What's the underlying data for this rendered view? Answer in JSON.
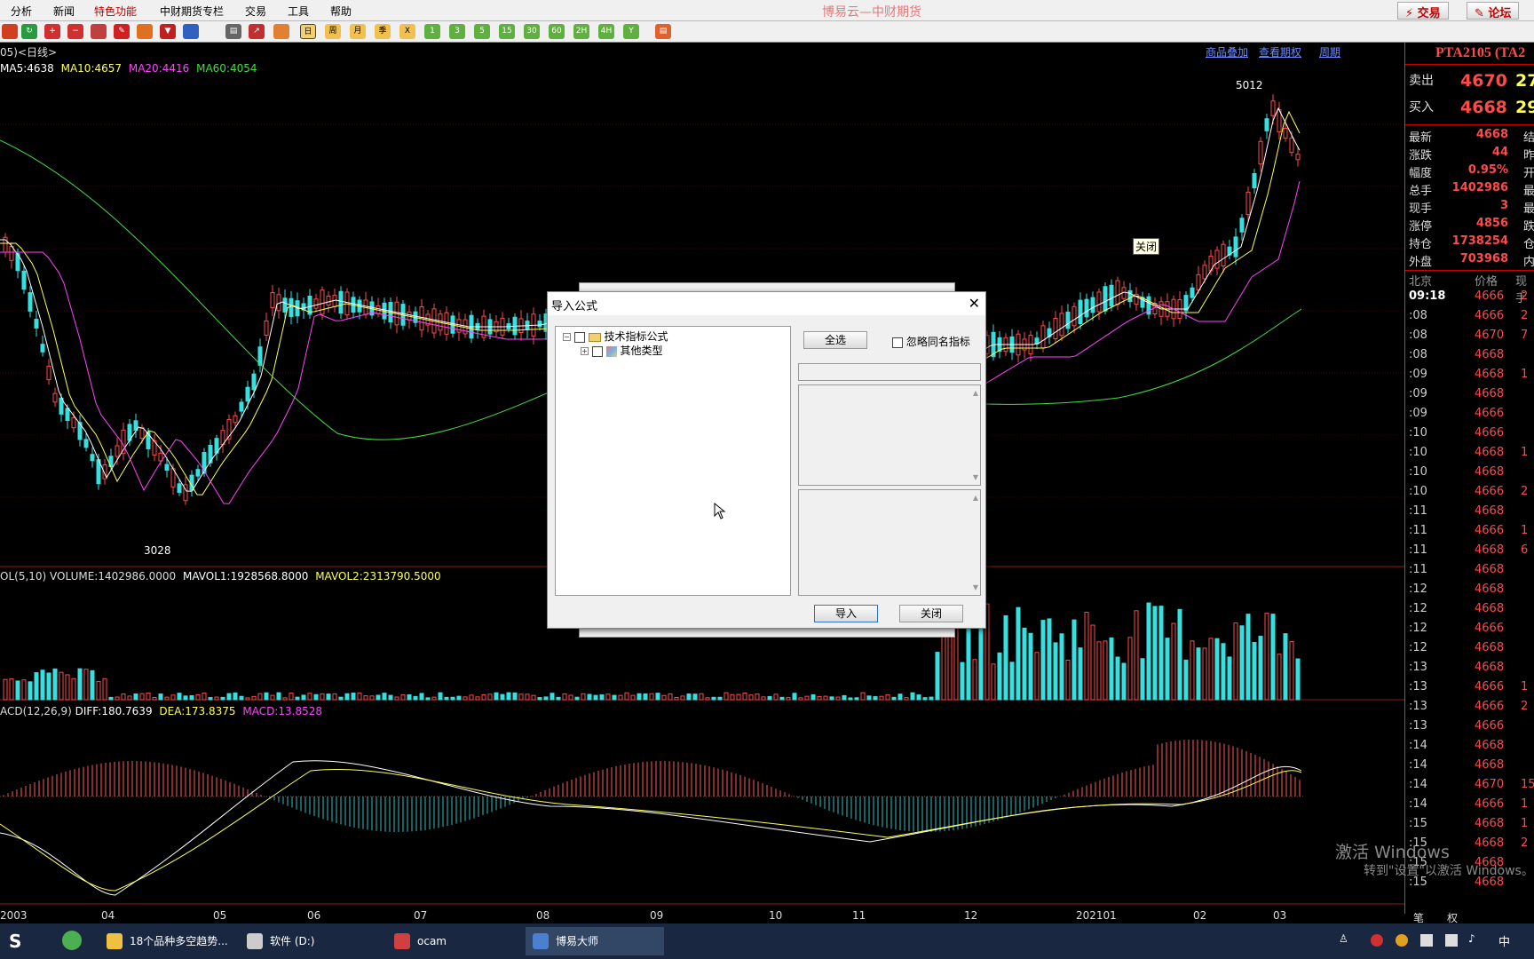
{
  "menu": [
    "分析",
    "新闻",
    "特色功能",
    "中财期货专栏",
    "交易",
    "工具",
    "帮助"
  ],
  "app_title": "博易云—中财期货",
  "top_buttons": {
    "trade": "交易",
    "forum": "论坛"
  },
  "toolbar_periods": [
    "日",
    "周",
    "月",
    "季",
    "X",
    "1",
    "3",
    "5",
    "15",
    "30",
    "60",
    "2H",
    "4H",
    "Y"
  ],
  "chart": {
    "period_label": "05)<日线>",
    "ma_labels": [
      "MA5:4638",
      "MA10:4657",
      "MA20:4416",
      "MA60:4054"
    ],
    "ma_colors": [
      "#ffffff",
      "#ffff55",
      "#ff44ff",
      "#44dd44"
    ],
    "high_label": "5012",
    "low_label": "3028",
    "close_tag": "关闭",
    "links": [
      "商品叠加",
      "查看期权",
      "周期"
    ],
    "vol_label_prefix": "OL(5,10)",
    "vol_labels": [
      "VOLUME:1402986.0000",
      "MAVOL1:1928568.8000",
      "MAVOL2:2313790.5000"
    ],
    "macd_label_prefix": "ACD(12,26,9)",
    "macd_labels": [
      "DIFF:180.7639",
      "DEA:173.8375",
      "MACD:13.8528"
    ],
    "x_labels": [
      "2003",
      "04",
      "05",
      "06",
      "07",
      "08",
      "09",
      "10",
      "11",
      "12",
      "202101",
      "02",
      "03"
    ]
  },
  "quote_panel": {
    "symbol": "PTA2105 (TA2",
    "ask": {
      "label": "卖出",
      "price": "4670",
      "vol": "27"
    },
    "bid": {
      "label": "买入",
      "price": "4668",
      "vol": "29"
    },
    "stats": [
      {
        "k": "最新",
        "v": "4668",
        "k2": "结"
      },
      {
        "k": "涨跌",
        "v": "44",
        "k2": "昨"
      },
      {
        "k": "幅度",
        "v": "0.95%",
        "k2": "开"
      },
      {
        "k": "总手",
        "v": "1402986",
        "k2": "最"
      },
      {
        "k": "现手",
        "v": "3",
        "k2": "最"
      },
      {
        "k": "涨停",
        "v": "4856",
        "k2": "跌"
      },
      {
        "k": "持仓",
        "v": "1738254",
        "k2": "仓"
      },
      {
        "k": "外盘",
        "v": "703968",
        "k2": "内"
      }
    ],
    "tick_header": [
      "北京",
      "价格",
      "现手"
    ],
    "ticks": [
      {
        "t": "09:18",
        "p": "4666",
        "q": "2"
      },
      {
        "t": ":08",
        "p": "4666",
        "q": "2"
      },
      {
        "t": ":08",
        "p": "4670",
        "q": "7"
      },
      {
        "t": ":08",
        "p": "4668",
        "q": ""
      },
      {
        "t": ":09",
        "p": "4668",
        "q": "1"
      },
      {
        "t": ":09",
        "p": "4668",
        "q": ""
      },
      {
        "t": ":09",
        "p": "4666",
        "q": ""
      },
      {
        "t": ":10",
        "p": "4666",
        "q": ""
      },
      {
        "t": ":10",
        "p": "4668",
        "q": "1"
      },
      {
        "t": ":10",
        "p": "4668",
        "q": ""
      },
      {
        "t": ":10",
        "p": "4666",
        "q": "2"
      },
      {
        "t": ":11",
        "p": "4668",
        "q": ""
      },
      {
        "t": ":11",
        "p": "4666",
        "q": "1"
      },
      {
        "t": ":11",
        "p": "4668",
        "q": "6"
      },
      {
        "t": ":11",
        "p": "4668",
        "q": ""
      },
      {
        "t": ":12",
        "p": "4668",
        "q": ""
      },
      {
        "t": ":12",
        "p": "4668",
        "q": ""
      },
      {
        "t": ":12",
        "p": "4666",
        "q": ""
      },
      {
        "t": ":12",
        "p": "4668",
        "q": ""
      },
      {
        "t": ":13",
        "p": "4668",
        "q": ""
      },
      {
        "t": ":13",
        "p": "4666",
        "q": "1"
      },
      {
        "t": ":13",
        "p": "4666",
        "q": "2"
      },
      {
        "t": ":13",
        "p": "4666",
        "q": ""
      },
      {
        "t": ":14",
        "p": "4668",
        "q": ""
      },
      {
        "t": ":14",
        "p": "4668",
        "q": ""
      },
      {
        "t": ":14",
        "p": "4670",
        "q": "15"
      },
      {
        "t": ":14",
        "p": "4666",
        "q": "1"
      },
      {
        "t": ":15",
        "p": "4668",
        "q": "1"
      },
      {
        "t": ":15",
        "p": "4668",
        "q": "2"
      },
      {
        "t": ":15",
        "p": "4668",
        "q": ""
      },
      {
        "t": ":15",
        "p": "4668",
        "q": ""
      }
    ],
    "bottom_tabs": [
      "笔",
      "权"
    ]
  },
  "dialog": {
    "title": "导入公式",
    "tree_root": "技术指标公式",
    "tree_child": "其他类型",
    "select_all": "全选",
    "ignore_same": "忽略同名指标",
    "import_btn": "导入",
    "close_btn": "关闭"
  },
  "watermark": {
    "line1": "激活 Windows",
    "line2": "转到\"设置\"以激活 Windows。"
  },
  "taskbar": {
    "tasks": [
      "18个品种多空趋势...",
      "软件 (D:)",
      "ocam",
      "博易大师"
    ],
    "tray_lang": "中"
  }
}
